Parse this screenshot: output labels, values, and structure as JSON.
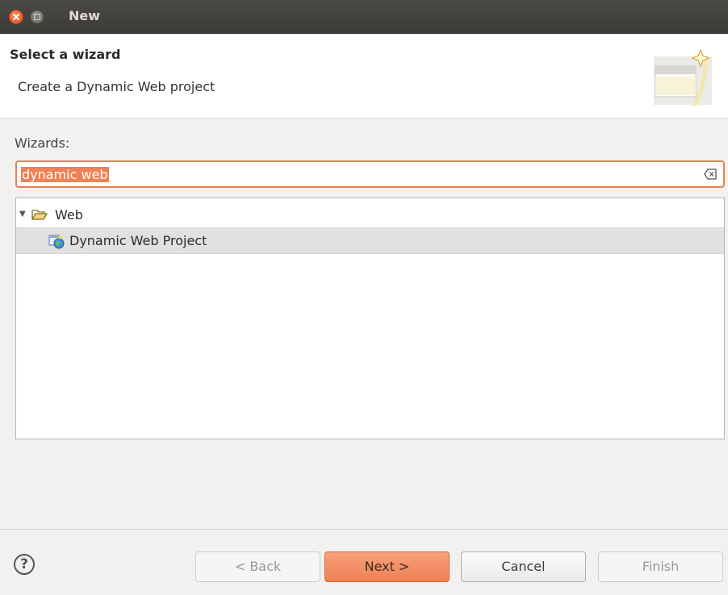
{
  "window": {
    "title": "New"
  },
  "header": {
    "title": "Select a wizard",
    "description": "Create a Dynamic Web project"
  },
  "wizards": {
    "label": "Wizards:",
    "filter_value": "dynamic web",
    "tree": [
      {
        "label": "Web",
        "icon": "folder-open-icon",
        "expanded": true
      },
      {
        "label": "Dynamic Web Project",
        "icon": "web-project-icon",
        "selected": true
      }
    ]
  },
  "buttons": {
    "help": "?",
    "back": "< Back",
    "next": "Next >",
    "cancel": "Cancel",
    "finish": "Finish"
  },
  "colors": {
    "accent": "#ef8154",
    "titlebar": "#3c3b37",
    "selection": "#e2e1df"
  }
}
